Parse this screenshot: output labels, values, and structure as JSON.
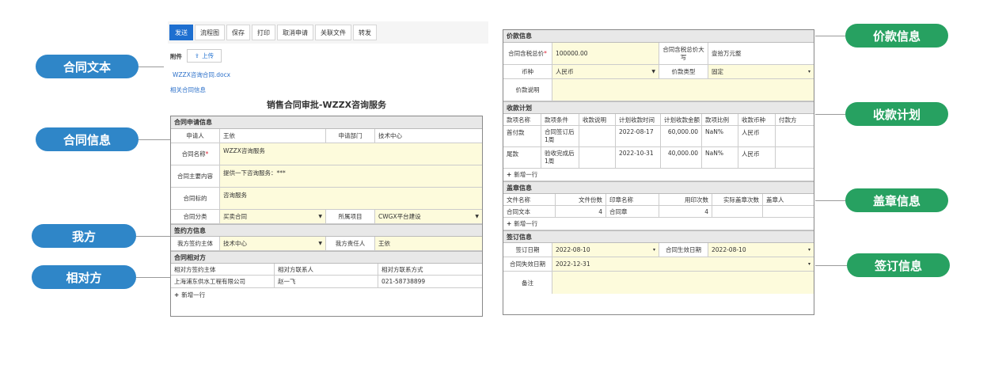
{
  "callouts_left": [
    "合同文本",
    "合同信息",
    "我方",
    "相对方"
  ],
  "callouts_right": [
    "价款信息",
    "收款计划",
    "盖章信息",
    "签订信息"
  ],
  "toolbar": [
    "发送",
    "流程图",
    "保存",
    "打印",
    "取消申请",
    "关联文件",
    "转发"
  ],
  "attachment": {
    "label": "附件",
    "upload": "上传",
    "file": "WZZX咨询合同.docx",
    "related": "相关合同信息"
  },
  "title": "销售合同审批-WZZX咨询服务",
  "contract_info": {
    "section": "合同申请信息",
    "applicant_label": "申请人",
    "applicant": "王依",
    "dept_label": "申请部门",
    "dept": "技术中心",
    "name_label": "合同名称",
    "name": "WZZX咨询服务",
    "content_label": "合同主要内容",
    "content": "提供一下咨询服务：***",
    "subject_label": "合同标的",
    "subject": "咨询服务",
    "category_label": "合同分类",
    "category": "买卖合同",
    "project_label": "所属项目",
    "project": "CWGX平台建设"
  },
  "our_side": {
    "section": "签约方信息",
    "entity_label": "我方签约主体",
    "entity": "技术中心",
    "owner_label": "我方责任人",
    "owner": "王依"
  },
  "counterparty": {
    "section": "合同相对方",
    "headers": [
      "相对方签约主体",
      "相对方联系人",
      "相对方联系方式"
    ],
    "row": [
      "上海浦东供水工程有限公司",
      "赵一飞",
      "021-58738899"
    ],
    "add": "新增一行"
  },
  "price": {
    "section": "价款信息",
    "total_label": "合同含税总价",
    "total": "100000.00",
    "upper_label": "合同含税总价大写",
    "upper": "壹拾万元整",
    "currency_label": "币种",
    "currency": "人民币",
    "type_label": "价款类型",
    "type": "固定",
    "note_label": "价款说明"
  },
  "payment_plan": {
    "section": "收款计划",
    "headers": [
      "款项名称",
      "款项条件",
      "收款说明",
      "计划收款时间",
      "计划收款金额",
      "款项比例",
      "收款币种",
      "付款方"
    ],
    "rows": [
      [
        "首付款",
        "合同签订后1周",
        "",
        "2022-08-17",
        "60,000.00",
        "NaN%",
        "人民币",
        ""
      ],
      [
        "尾款",
        "验收完成后1周",
        "",
        "2022-10-31",
        "40,000.00",
        "NaN%",
        "人民币",
        ""
      ]
    ],
    "add": "新增一行"
  },
  "seal": {
    "section": "盖章信息",
    "headers": [
      "文件名称",
      "文件份数",
      "印章名称",
      "用印次数",
      "实际盖章次数",
      "盖章人"
    ],
    "row": [
      "合同文本",
      "4",
      "合同章",
      "4",
      "",
      ""
    ],
    "add": "新增一行"
  },
  "signing": {
    "section": "签订信息",
    "sign_date_label": "签订日期",
    "sign_date": "2022-08-10",
    "effective_label": "合同生效日期",
    "effective": "2022-08-10",
    "expire_label": "合同失效日期",
    "expire": "2022-12-31",
    "remark_label": "备注"
  }
}
